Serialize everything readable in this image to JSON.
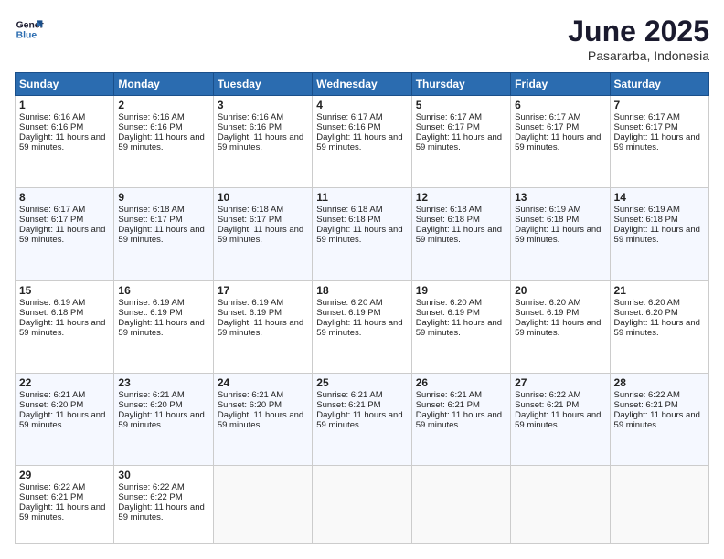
{
  "logo": {
    "line1": "General",
    "line2": "Blue"
  },
  "title": "June 2025",
  "location": "Pasararba, Indonesia",
  "days_header": [
    "Sunday",
    "Monday",
    "Tuesday",
    "Wednesday",
    "Thursday",
    "Friday",
    "Saturday"
  ],
  "weeks": [
    [
      {
        "day": "1",
        "sunrise": "6:16 AM",
        "sunset": "6:16 PM",
        "daylight": "11 hours and 59 minutes."
      },
      {
        "day": "2",
        "sunrise": "6:16 AM",
        "sunset": "6:16 PM",
        "daylight": "11 hours and 59 minutes."
      },
      {
        "day": "3",
        "sunrise": "6:16 AM",
        "sunset": "6:16 PM",
        "daylight": "11 hours and 59 minutes."
      },
      {
        "day": "4",
        "sunrise": "6:17 AM",
        "sunset": "6:16 PM",
        "daylight": "11 hours and 59 minutes."
      },
      {
        "day": "5",
        "sunrise": "6:17 AM",
        "sunset": "6:17 PM",
        "daylight": "11 hours and 59 minutes."
      },
      {
        "day": "6",
        "sunrise": "6:17 AM",
        "sunset": "6:17 PM",
        "daylight": "11 hours and 59 minutes."
      },
      {
        "day": "7",
        "sunrise": "6:17 AM",
        "sunset": "6:17 PM",
        "daylight": "11 hours and 59 minutes."
      }
    ],
    [
      {
        "day": "8",
        "sunrise": "6:17 AM",
        "sunset": "6:17 PM",
        "daylight": "11 hours and 59 minutes."
      },
      {
        "day": "9",
        "sunrise": "6:18 AM",
        "sunset": "6:17 PM",
        "daylight": "11 hours and 59 minutes."
      },
      {
        "day": "10",
        "sunrise": "6:18 AM",
        "sunset": "6:17 PM",
        "daylight": "11 hours and 59 minutes."
      },
      {
        "day": "11",
        "sunrise": "6:18 AM",
        "sunset": "6:18 PM",
        "daylight": "11 hours and 59 minutes."
      },
      {
        "day": "12",
        "sunrise": "6:18 AM",
        "sunset": "6:18 PM",
        "daylight": "11 hours and 59 minutes."
      },
      {
        "day": "13",
        "sunrise": "6:19 AM",
        "sunset": "6:18 PM",
        "daylight": "11 hours and 59 minutes."
      },
      {
        "day": "14",
        "sunrise": "6:19 AM",
        "sunset": "6:18 PM",
        "daylight": "11 hours and 59 minutes."
      }
    ],
    [
      {
        "day": "15",
        "sunrise": "6:19 AM",
        "sunset": "6:18 PM",
        "daylight": "11 hours and 59 minutes."
      },
      {
        "day": "16",
        "sunrise": "6:19 AM",
        "sunset": "6:19 PM",
        "daylight": "11 hours and 59 minutes."
      },
      {
        "day": "17",
        "sunrise": "6:19 AM",
        "sunset": "6:19 PM",
        "daylight": "11 hours and 59 minutes."
      },
      {
        "day": "18",
        "sunrise": "6:20 AM",
        "sunset": "6:19 PM",
        "daylight": "11 hours and 59 minutes."
      },
      {
        "day": "19",
        "sunrise": "6:20 AM",
        "sunset": "6:19 PM",
        "daylight": "11 hours and 59 minutes."
      },
      {
        "day": "20",
        "sunrise": "6:20 AM",
        "sunset": "6:19 PM",
        "daylight": "11 hours and 59 minutes."
      },
      {
        "day": "21",
        "sunrise": "6:20 AM",
        "sunset": "6:20 PM",
        "daylight": "11 hours and 59 minutes."
      }
    ],
    [
      {
        "day": "22",
        "sunrise": "6:21 AM",
        "sunset": "6:20 PM",
        "daylight": "11 hours and 59 minutes."
      },
      {
        "day": "23",
        "sunrise": "6:21 AM",
        "sunset": "6:20 PM",
        "daylight": "11 hours and 59 minutes."
      },
      {
        "day": "24",
        "sunrise": "6:21 AM",
        "sunset": "6:20 PM",
        "daylight": "11 hours and 59 minutes."
      },
      {
        "day": "25",
        "sunrise": "6:21 AM",
        "sunset": "6:21 PM",
        "daylight": "11 hours and 59 minutes."
      },
      {
        "day": "26",
        "sunrise": "6:21 AM",
        "sunset": "6:21 PM",
        "daylight": "11 hours and 59 minutes."
      },
      {
        "day": "27",
        "sunrise": "6:22 AM",
        "sunset": "6:21 PM",
        "daylight": "11 hours and 59 minutes."
      },
      {
        "day": "28",
        "sunrise": "6:22 AM",
        "sunset": "6:21 PM",
        "daylight": "11 hours and 59 minutes."
      }
    ],
    [
      {
        "day": "29",
        "sunrise": "6:22 AM",
        "sunset": "6:21 PM",
        "daylight": "11 hours and 59 minutes."
      },
      {
        "day": "30",
        "sunrise": "6:22 AM",
        "sunset": "6:22 PM",
        "daylight": "11 hours and 59 minutes."
      },
      null,
      null,
      null,
      null,
      null
    ]
  ]
}
